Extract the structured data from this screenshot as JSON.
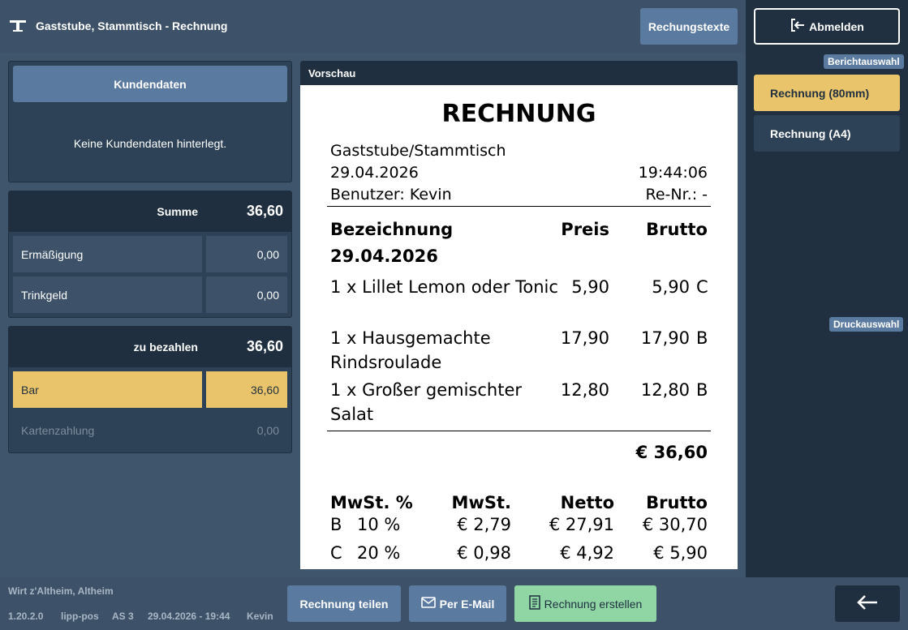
{
  "header": {
    "title": "Gaststube, Stammtisch - Rechnung",
    "texts_button": "Rechungstexte"
  },
  "right": {
    "logout_label": "Abmelden",
    "report_tag": "Berichtauswahl",
    "reports": [
      "Rechnung (80mm)",
      "Rechnung (A4)"
    ],
    "print_tag": "Druckauswahl"
  },
  "customer": {
    "button": "Kundendaten",
    "empty_text": "Keine Kundendaten hinterlegt."
  },
  "sum": {
    "label": "Summe",
    "value": "36,60",
    "discount_label": "Ermäßigung",
    "discount_value": "0,00",
    "tip_label": "Trinkgeld",
    "tip_value": "0,00"
  },
  "pay": {
    "label": "zu bezahlen",
    "value": "36,60",
    "cash_label": "Bar",
    "cash_value": "36,60",
    "card_label": "Kartenzahlung",
    "card_value": "0,00"
  },
  "preview": {
    "header": "Vorschau",
    "title": "RECHNUNG",
    "location": "Gaststube/Stammtisch",
    "date": "29.04.2026",
    "time": "19:44:06",
    "user": "Benutzer: Kevin",
    "receipt_no": "Re-Nr.: -",
    "col_name": "Bezeichnung",
    "col_price": "Preis",
    "col_gross": "Brutto",
    "group_date": "29.04.2026",
    "items": [
      {
        "line1": "1 x Lillet Lemon oder Tonic",
        "line2": "",
        "price": "5,90",
        "gross": "5,90",
        "tax": "C"
      },
      {
        "line1": "1 x Hausgemachte",
        "line2": "Rindsroulade",
        "price": "17,90",
        "gross": "17,90",
        "tax": "B"
      },
      {
        "line1": "1 x Großer gemischter",
        "line2": "Salat",
        "price": "12,80",
        "gross": "12,80",
        "tax": "B"
      }
    ],
    "total": "€ 36,60",
    "vat_headers": [
      "MwSt. %",
      "MwSt.",
      "Netto",
      "Brutto"
    ],
    "vat_rows": [
      {
        "code": "B",
        "rate": "10 %",
        "vat": "€ 2,79",
        "net": "€ 27,91",
        "gross": "€ 30,70"
      },
      {
        "code": "C",
        "rate": "20 %",
        "vat": "€ 0,98",
        "net": "€ 4,92",
        "gross": "€ 5,90"
      }
    ]
  },
  "footer": {
    "venue": "Wirt z'Altheim, Altheim",
    "version": "1.20.2.0",
    "app": "lipp-pos",
    "station": "AS 3",
    "datetime": "29.04.2026 - 19:44",
    "user": "Kevin",
    "split_button": "Rechnung teilen",
    "email_button": "Per E-Mail",
    "create_button": "Rechnung erstellen"
  },
  "colors": {
    "accent": "#e9c46a",
    "primary": "#5b7aa0",
    "success": "#8fd6a4",
    "dark": "#1f2f3f"
  }
}
